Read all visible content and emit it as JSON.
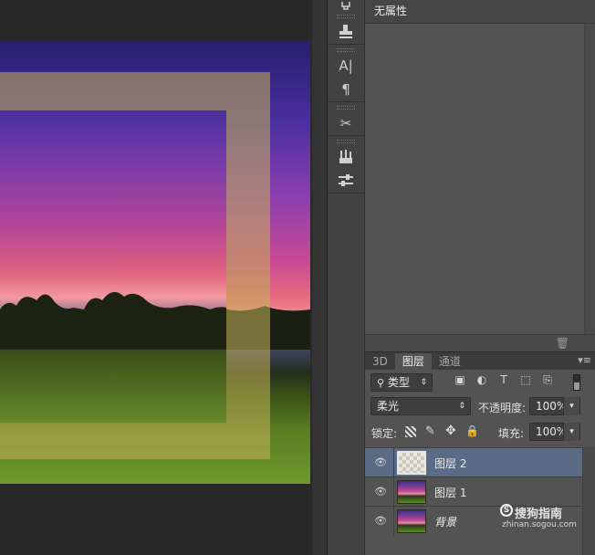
{
  "properties": {
    "title": "无属性"
  },
  "tools": [
    {
      "icon": "history-brush-icon"
    },
    {
      "icon": "clone-stamp-icon"
    },
    {
      "icon": "character-icon",
      "glyph": "A|"
    },
    {
      "icon": "paragraph-icon",
      "glyph": "¶"
    },
    {
      "icon": "tools-icon",
      "glyph": "✂"
    },
    {
      "icon": "brush-presets-icon"
    },
    {
      "icon": "adjustments-icon"
    }
  ],
  "layers_panel": {
    "tabs": [
      {
        "label": "3D",
        "active": false
      },
      {
        "label": "图层",
        "active": true
      },
      {
        "label": "通道",
        "active": false
      }
    ],
    "filter": {
      "label": "类型"
    },
    "blend_mode": "柔光",
    "opacity_label": "不透明度:",
    "opacity_value": "100%",
    "lock_label": "锁定:",
    "fill_label": "填充:",
    "fill_value": "100%",
    "layers": [
      {
        "name": "图层 2",
        "selected": true,
        "thumb": "transparent"
      },
      {
        "name": "图层 1",
        "selected": false,
        "thumb": "photo"
      },
      {
        "name": "背景",
        "selected": false,
        "thumb": "photo"
      }
    ]
  },
  "watermark": {
    "brand": "搜狗指南",
    "url": "zhinan.sogou.com"
  },
  "colors": {
    "selected_layer": "#5a6b86",
    "panel_bg": "#535353",
    "canvas_bg": "#282828"
  }
}
